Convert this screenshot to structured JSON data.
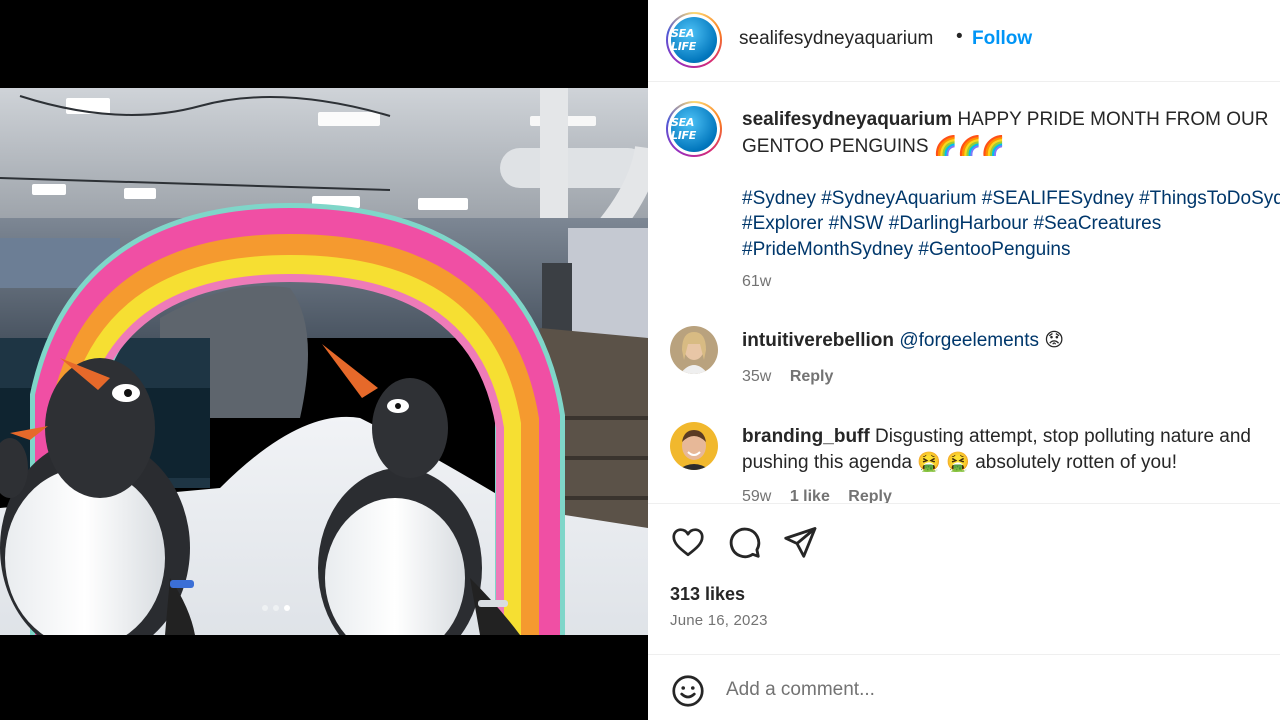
{
  "header": {
    "avatar_logo": "SEA LIFE",
    "username": "sealifesydneyaquarium",
    "separator": "•",
    "follow_label": "Follow"
  },
  "caption": {
    "username": "sealifesydneyaquarium",
    "text_line1": "HAPPY PRIDE MONTH FROM OUR",
    "text_line2": "GENTOO PENGUINS 🌈🌈🌈",
    "hashtags_line1": "#Sydney #SydneyAquarium #SEALIFESydney #ThingsToDoSyd",
    "hashtags_line2": "#Explorer #NSW #DarlingHarbour #SeaCreatures",
    "hashtags_line3": "#PrideMonthSydney #GentooPenguins",
    "time": "61w"
  },
  "comments": [
    {
      "username": "intuitiverebellion",
      "mention": "@forgeelements",
      "text": "😟",
      "time": "35w",
      "reply_label": "Reply"
    },
    {
      "username": "branding_buff",
      "text_line1": "Disgusting attempt, stop polluting nature and",
      "text_line2": "pushing this agenda 🤮 🤮 absolutely rotten of you!",
      "time": "59w",
      "likes": "1 like",
      "reply_label": "Reply"
    }
  ],
  "post": {
    "likes": "313 likes",
    "date": "June 16, 2023"
  },
  "add_comment": {
    "placeholder": "Add a comment..."
  },
  "carousel": {
    "total": 3,
    "active_index": 2
  },
  "icons": {
    "like": "heart-icon",
    "comment": "comment-bubble-icon",
    "share": "paper-plane-icon",
    "emoji": "smiley-icon"
  },
  "colors": {
    "follow": "#0095f6",
    "hashtag": "#00376b",
    "muted": "#737373"
  }
}
